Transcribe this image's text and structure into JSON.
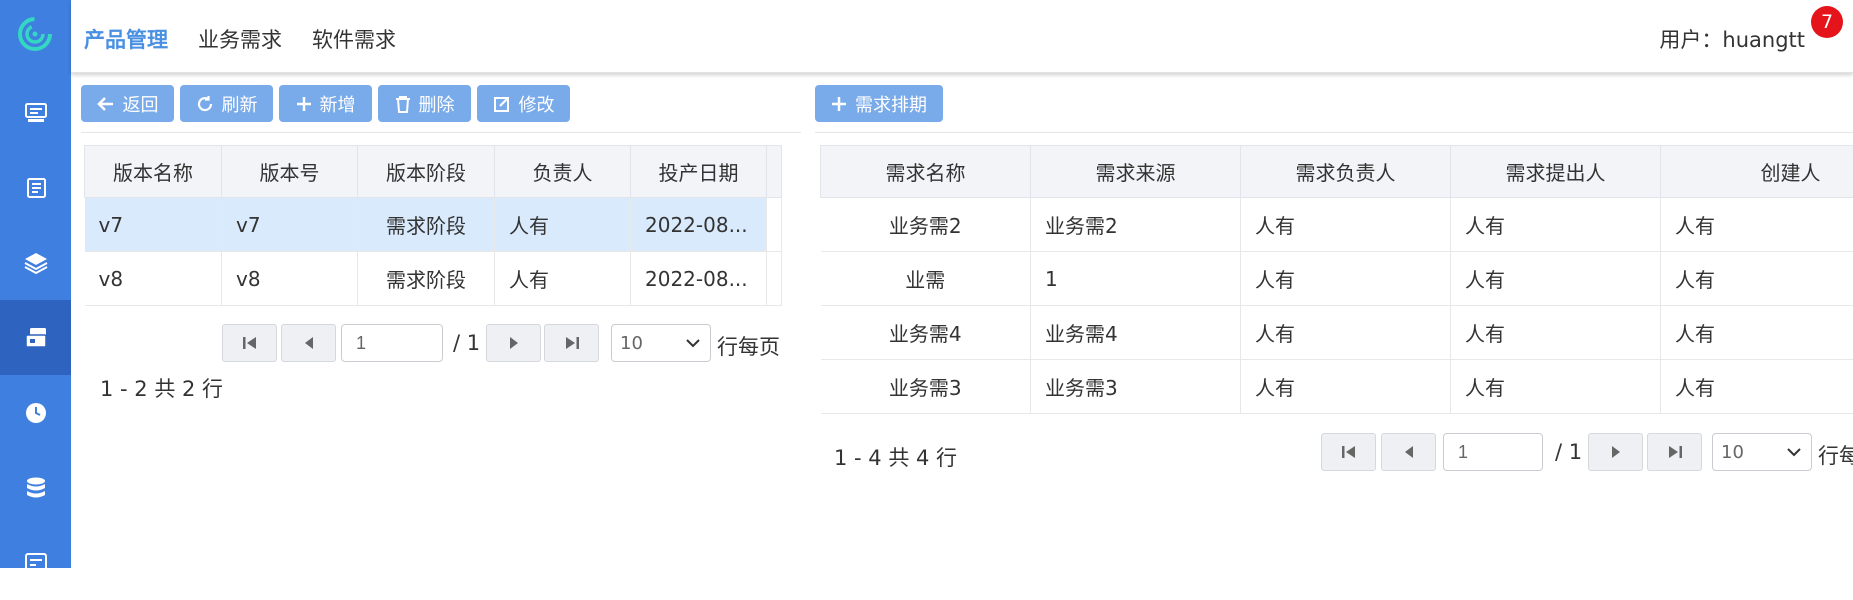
{
  "header": {
    "menus": [
      "产品管理",
      "业务需求",
      "软件需求"
    ],
    "user_label": "用户：huangtt",
    "badge_count": "7"
  },
  "sidebar": {
    "items": [
      "monitor-icon",
      "book-icon",
      "layers-icon",
      "cards-icon",
      "clock-icon",
      "database-icon",
      "dashboard-icon"
    ],
    "active_index": 3
  },
  "left_toolbar": {
    "back": "返回",
    "refresh": "刷新",
    "add": "新增",
    "delete": "删除",
    "edit": "修改"
  },
  "right_toolbar": {
    "schedule": "需求排期"
  },
  "version_table": {
    "columns": [
      "版本名称",
      "版本号",
      "版本阶段",
      "负责人",
      "投产日期"
    ],
    "rows": [
      [
        "v7",
        "v7",
        "需求阶段",
        "人有",
        "2022-08..."
      ],
      [
        "v8",
        "v8",
        "需求阶段",
        "人有",
        "2022-08..."
      ]
    ],
    "selected_row": 0
  },
  "left_pager": {
    "page": "1",
    "total_pages": "/ 1",
    "page_size": "10",
    "rows_label": "行每页",
    "summary": "1 - 2 共 2 行"
  },
  "demand_table": {
    "columns": [
      "需求名称",
      "需求来源",
      "需求负责人",
      "需求提出人",
      "创建人"
    ],
    "rows": [
      [
        "业务需2",
        "业务需2",
        "人有",
        "人有",
        "人有"
      ],
      [
        "业需",
        "1",
        "人有",
        "人有",
        "人有"
      ],
      [
        "业务需4",
        "业务需4",
        "人有",
        "人有",
        "人有"
      ],
      [
        "业务需3",
        "业务需3",
        "人有",
        "人有",
        "人有"
      ]
    ]
  },
  "right_pager": {
    "page": "1",
    "total_pages": "/ 1",
    "page_size": "10",
    "rows_label": "行每",
    "summary": "1 - 4 共 4 行"
  },
  "colors": {
    "sidebar": "#3f7fe0",
    "sidebar_active": "#2e63bf",
    "button": "#79aaea",
    "active_menu": "#4a90e2",
    "selected_row": "#d9eafc",
    "badge": "#e5141a"
  }
}
